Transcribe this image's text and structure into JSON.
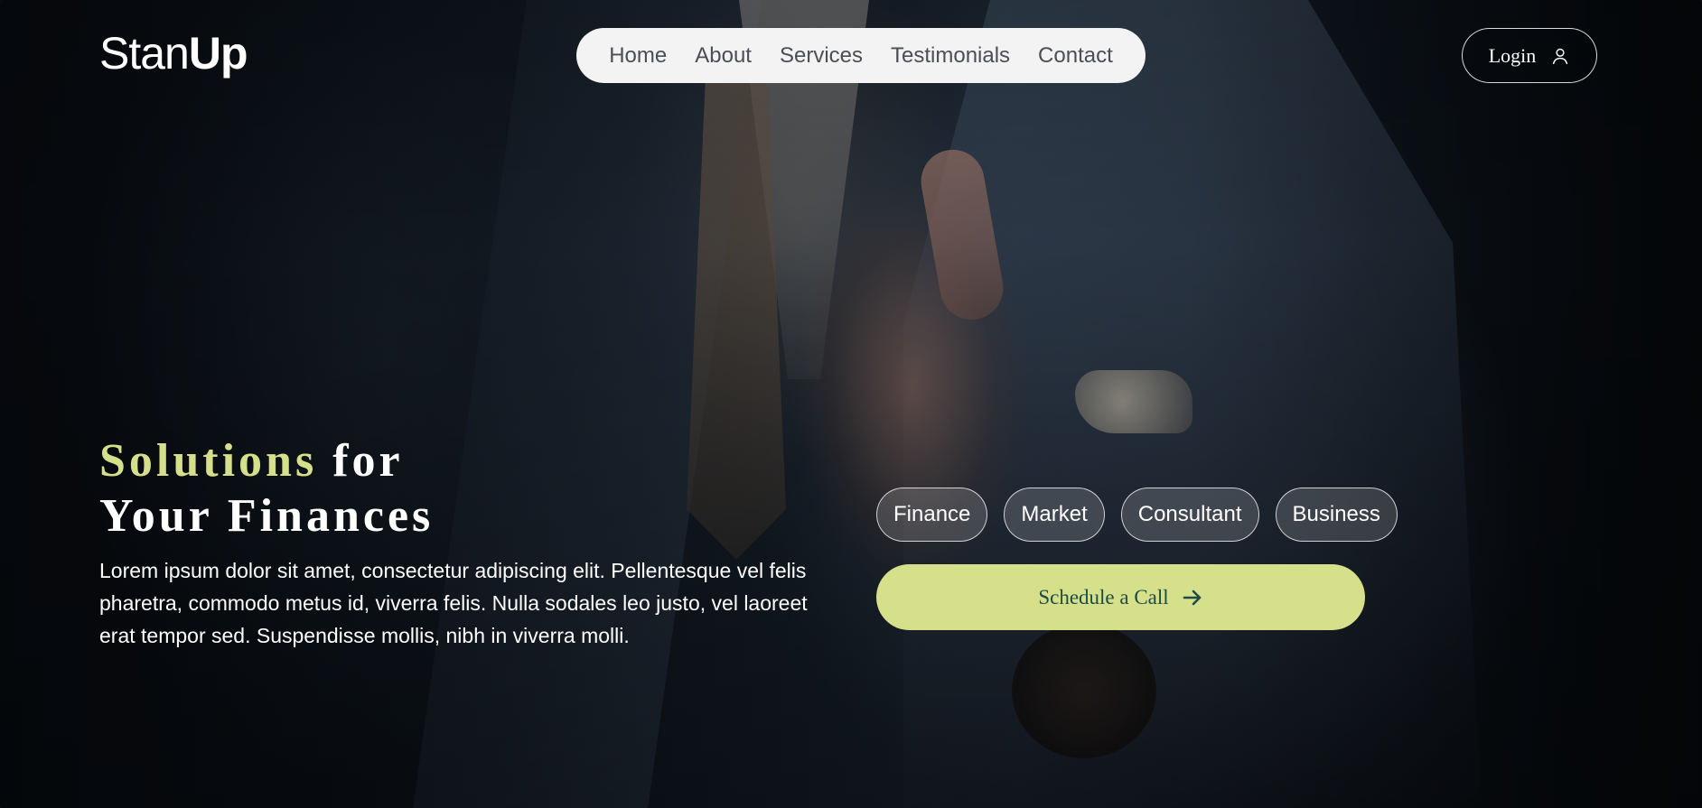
{
  "brand": {
    "logo_light": "Stan",
    "logo_bold": "Up"
  },
  "nav": {
    "items": [
      {
        "label": "Home"
      },
      {
        "label": "About"
      },
      {
        "label": "Services"
      },
      {
        "label": "Testimonials"
      },
      {
        "label": "Contact"
      }
    ]
  },
  "header": {
    "login_label": "Login",
    "login_icon": "user-icon"
  },
  "hero": {
    "headline_accent": "Solutions",
    "headline_rest_line1": "for",
    "headline_line2": "Your Finances",
    "lead": "Lorem ipsum dolor sit amet, consectetur adipiscing elit. Pellentesque vel felis pharetra, commodo metus id, viverra felis. Nulla sodales leo justo, vel laoreet erat tempor sed. Suspendisse mollis, nibh in viverra molli.",
    "tags": [
      "Finance",
      "Market",
      "Consultant",
      "Business"
    ],
    "cta_label": "Schedule a Call",
    "cta_icon": "arrow-right-icon"
  },
  "colors": {
    "accent": "#d6df8a",
    "cta_text": "#1d4c47",
    "nav_bg": "#f3f3f3",
    "nav_text": "#4a4f55"
  }
}
